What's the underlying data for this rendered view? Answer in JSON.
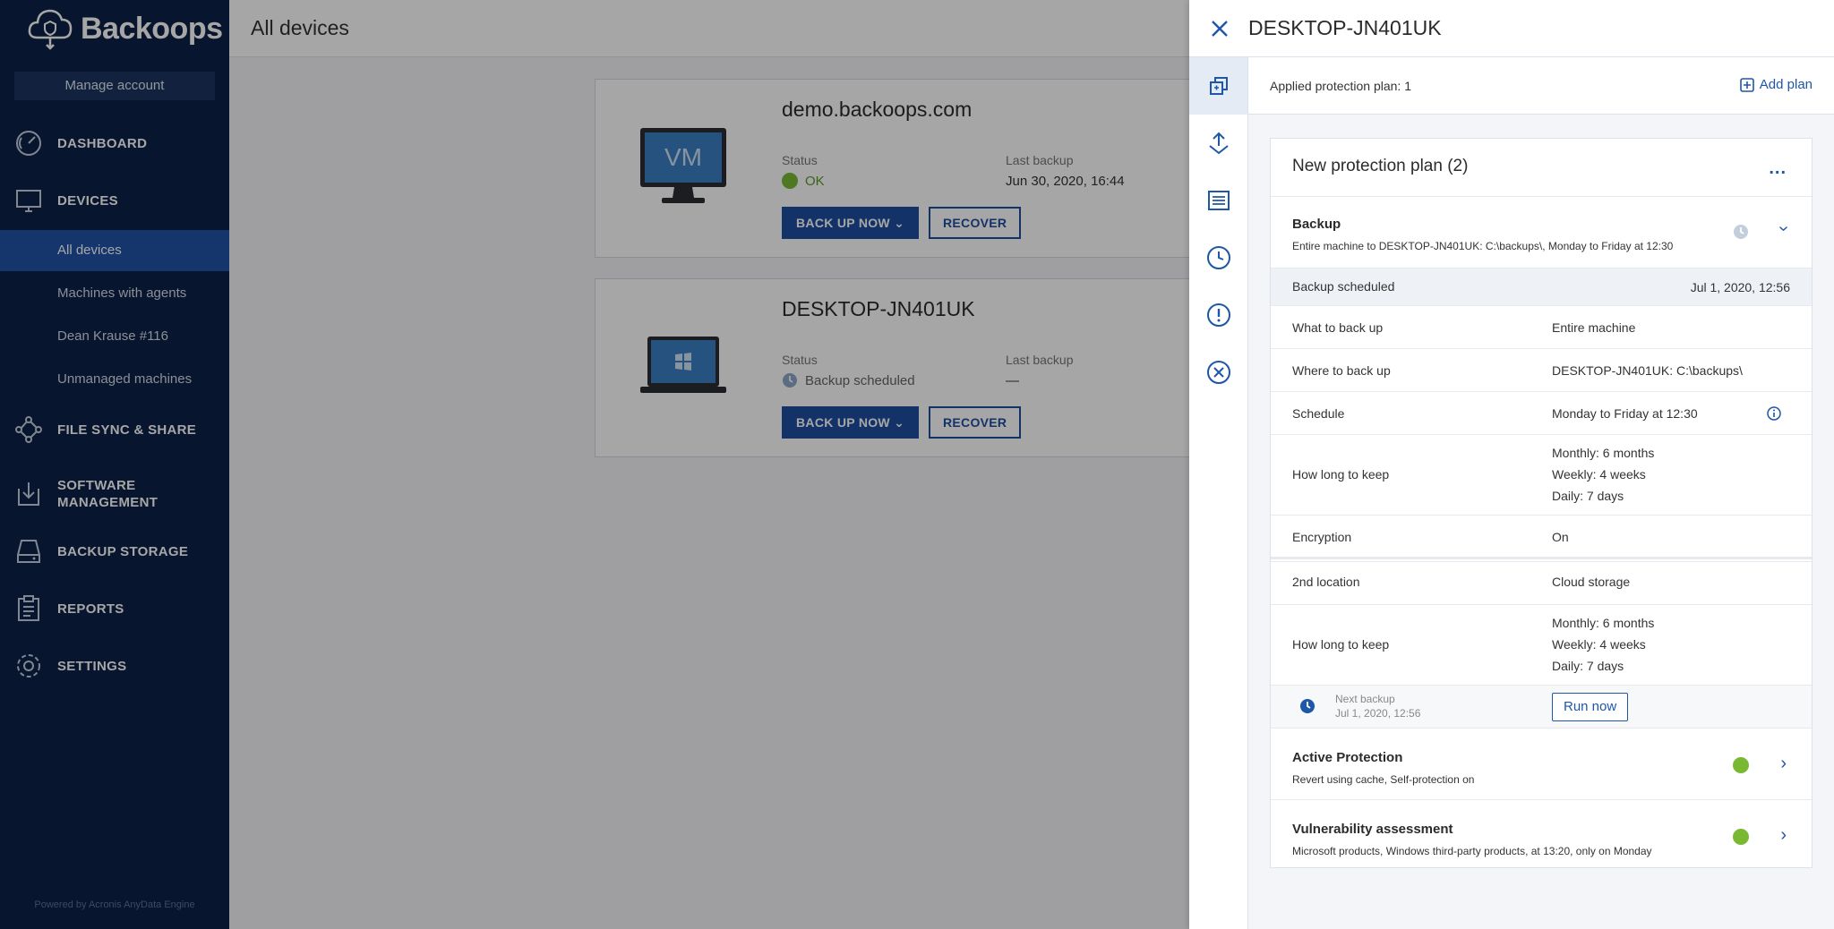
{
  "sidebar": {
    "logo_text": "Backoops",
    "manage_account": "Manage account",
    "nav": {
      "dashboard": "DASHBOARD",
      "devices": "DEVICES",
      "file_sync": "FILE SYNC & SHARE",
      "software_line1": "SOFTWARE",
      "software_line2": "MANAGEMENT",
      "backup_storage": "BACKUP STORAGE",
      "reports": "REPORTS",
      "settings": "SETTINGS"
    },
    "devices_sub": [
      "All devices",
      "Machines with agents",
      "Dean Krause #116",
      "Unmanaged machines"
    ],
    "powered_by": "Powered by Acronis AnyData Engine"
  },
  "main": {
    "title": "All devices",
    "cards": [
      {
        "name": "demo.backoops.com",
        "status_label": "Status",
        "status": "OK",
        "last_backup_label": "Last backup",
        "last_backup": "Jun 30, 2020, 16:44",
        "backup_btn": "BACK UP NOW",
        "recover_btn": "RECOVER",
        "icon_text": "VM"
      },
      {
        "name": "DESKTOP-JN401UK",
        "status_label": "Status",
        "status": "Backup scheduled",
        "last_backup_label": "Last backup",
        "last_backup": "—",
        "backup_btn": "BACK UP NOW",
        "recover_btn": "RECOVER"
      }
    ]
  },
  "panel": {
    "title": "DESKTOP-JN401UK",
    "applied": "Applied protection plan: 1",
    "add_plan": "Add plan",
    "plan": {
      "title": "New protection plan (2)",
      "more": "...",
      "backup": {
        "title": "Backup",
        "desc": "Entire machine to DESKTOP-JN401UK: C:\\backups\\, Monday to Friday at 12:30",
        "scheduled_label": "Backup scheduled",
        "scheduled_value": "Jul 1, 2020, 12:56",
        "what_label": "What to back up",
        "what_value": "Entire machine",
        "where_label": "Where to back up",
        "where_value": "DESKTOP-JN401UK: C:\\backups\\",
        "schedule_label": "Schedule",
        "schedule_value": "Monday to Friday at 12:30",
        "keep_label": "How long to keep",
        "keep_monthly": "Monthly: 6 months",
        "keep_weekly": "Weekly: 4 weeks",
        "keep_daily": "Daily: 7 days",
        "encryption_label": "Encryption",
        "encryption_value": "On",
        "second_label": "2nd location",
        "second_value": "Cloud storage",
        "keep2_label": "How long to keep",
        "keep2_monthly": "Monthly: 6 months",
        "keep2_weekly": "Weekly: 4 weeks",
        "keep2_daily": "Daily: 7 days",
        "next_label": "Next backup",
        "next_value": "Jul 1, 2020, 12:56",
        "run_now": "Run now"
      },
      "active": {
        "title": "Active Protection",
        "desc": "Revert using cache, Self-protection on"
      },
      "vuln": {
        "title": "Vulnerability assessment",
        "desc": "Microsoft products, Windows third-party products, at 13:20, only on Monday"
      }
    }
  },
  "colors": {
    "sidebar_bg": "#0b2147",
    "active_nav": "#1f54a8",
    "accent": "#1e56a8",
    "ok": "#78b833"
  }
}
